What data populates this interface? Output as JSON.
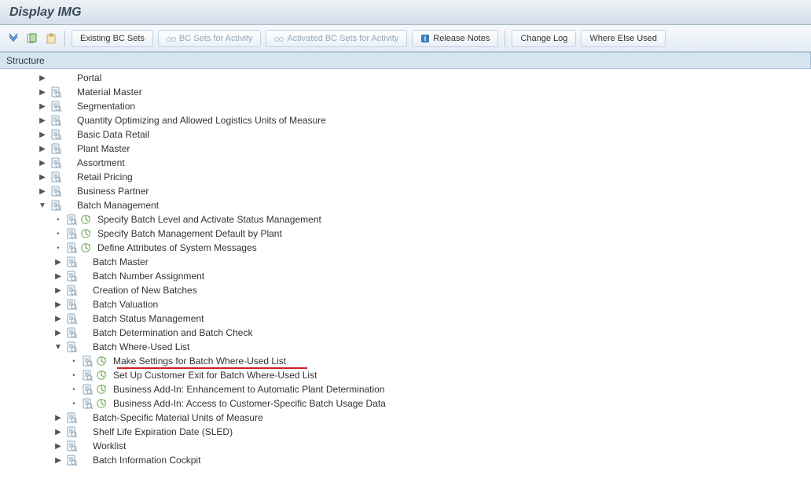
{
  "title": "Display IMG",
  "toolbar": {
    "existing_bc_sets": "Existing BC Sets",
    "bc_sets_for_activity": "BC Sets for Activity",
    "activated_bc_sets": "Activated BC Sets for Activity",
    "release_notes": "Release Notes",
    "change_log": "Change Log",
    "where_else_used": "Where Else Used"
  },
  "structure_label": "Structure",
  "tree": [
    {
      "level": 0,
      "kind": "branch",
      "label": "Portal",
      "expander": "▶",
      "doc": false,
      "exec": false
    },
    {
      "level": 0,
      "kind": "branch",
      "label": "Material Master",
      "expander": "▶",
      "doc": true,
      "exec": false
    },
    {
      "level": 0,
      "kind": "branch",
      "label": "Segmentation",
      "expander": "▶",
      "doc": true,
      "exec": false
    },
    {
      "level": 0,
      "kind": "branch",
      "label": "Quantity Optimizing and Allowed Logistics Units of Measure",
      "expander": "▶",
      "doc": true,
      "exec": false
    },
    {
      "level": 0,
      "kind": "branch",
      "label": "Basic Data Retail",
      "expander": "▶",
      "doc": true,
      "exec": false
    },
    {
      "level": 0,
      "kind": "branch",
      "label": "Plant Master",
      "expander": "▶",
      "doc": true,
      "exec": false
    },
    {
      "level": 0,
      "kind": "branch",
      "label": "Assortment",
      "expander": "▶",
      "doc": true,
      "exec": false
    },
    {
      "level": 0,
      "kind": "branch",
      "label": "Retail Pricing",
      "expander": "▶",
      "doc": true,
      "exec": false
    },
    {
      "level": 0,
      "kind": "branch",
      "label": "Business Partner",
      "expander": "▶",
      "doc": true,
      "exec": false
    },
    {
      "level": 0,
      "kind": "branch",
      "label": "Batch Management",
      "expander": "▼",
      "doc": true,
      "exec": false
    },
    {
      "level": 1,
      "kind": "leaf",
      "label": "Specify Batch Level and Activate Status Management",
      "doc": true,
      "exec": true
    },
    {
      "level": 1,
      "kind": "leaf",
      "label": "Specify Batch Management Default by Plant",
      "doc": true,
      "exec": true
    },
    {
      "level": 1,
      "kind": "leaf",
      "label": "Define Attributes of System Messages",
      "doc": true,
      "exec": true
    },
    {
      "level": 1,
      "kind": "branch",
      "label": "Batch Master",
      "expander": "▶",
      "doc": true,
      "exec": false
    },
    {
      "level": 1,
      "kind": "branch",
      "label": "Batch Number Assignment",
      "expander": "▶",
      "doc": true,
      "exec": false
    },
    {
      "level": 1,
      "kind": "branch",
      "label": "Creation of New Batches",
      "expander": "▶",
      "doc": true,
      "exec": false
    },
    {
      "level": 1,
      "kind": "branch",
      "label": "Batch Valuation",
      "expander": "▶",
      "doc": true,
      "exec": false
    },
    {
      "level": 1,
      "kind": "branch",
      "label": "Batch Status Management",
      "expander": "▶",
      "doc": true,
      "exec": false
    },
    {
      "level": 1,
      "kind": "branch",
      "label": "Batch Determination and Batch Check",
      "expander": "▶",
      "doc": true,
      "exec": false
    },
    {
      "level": 1,
      "kind": "branch",
      "label": "Batch Where-Used List",
      "expander": "▼",
      "doc": true,
      "exec": false
    },
    {
      "level": 2,
      "kind": "leaf",
      "label": "Make Settings for Batch Where-Used List",
      "doc": true,
      "exec": true,
      "highlight": true
    },
    {
      "level": 2,
      "kind": "leaf",
      "label": "Set Up Customer Exit for Batch Where-Used List",
      "doc": true,
      "exec": true
    },
    {
      "level": 2,
      "kind": "leaf",
      "label": "Business Add-In: Enhancement to Automatic Plant Determination",
      "doc": true,
      "exec": true
    },
    {
      "level": 2,
      "kind": "leaf",
      "label": "Business Add-In: Access to Customer-Specific Batch Usage Data",
      "doc": true,
      "exec": true
    },
    {
      "level": 1,
      "kind": "branch",
      "label": "Batch-Specific Material Units of Measure",
      "expander": "▶",
      "doc": true,
      "exec": false
    },
    {
      "level": 1,
      "kind": "branch",
      "label": "Shelf Life Expiration Date (SLED)",
      "expander": "▶",
      "doc": true,
      "exec": false
    },
    {
      "level": 1,
      "kind": "branch",
      "label": "Worklist",
      "expander": "▶",
      "doc": true,
      "exec": false
    },
    {
      "level": 1,
      "kind": "branch",
      "label": "Batch Information Cockpit",
      "expander": "▶",
      "doc": true,
      "exec": false
    }
  ]
}
